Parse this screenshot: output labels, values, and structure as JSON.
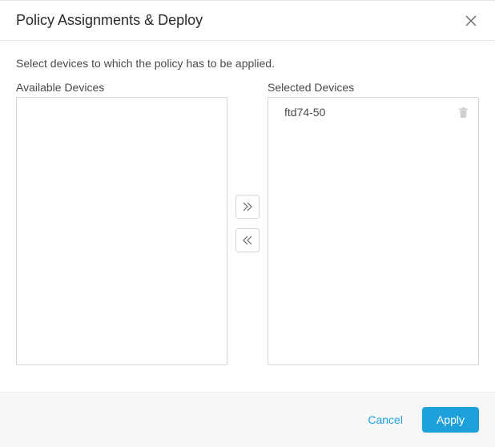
{
  "header": {
    "title": "Policy Assignments & Deploy"
  },
  "body": {
    "intro": "Select devices to which the policy has to be applied.",
    "available": {
      "label": "Available Devices",
      "items": []
    },
    "selected": {
      "label": "Selected Devices",
      "items": [
        "ftd74-50"
      ]
    }
  },
  "footer": {
    "cancel_label": "Cancel",
    "apply_label": "Apply"
  }
}
